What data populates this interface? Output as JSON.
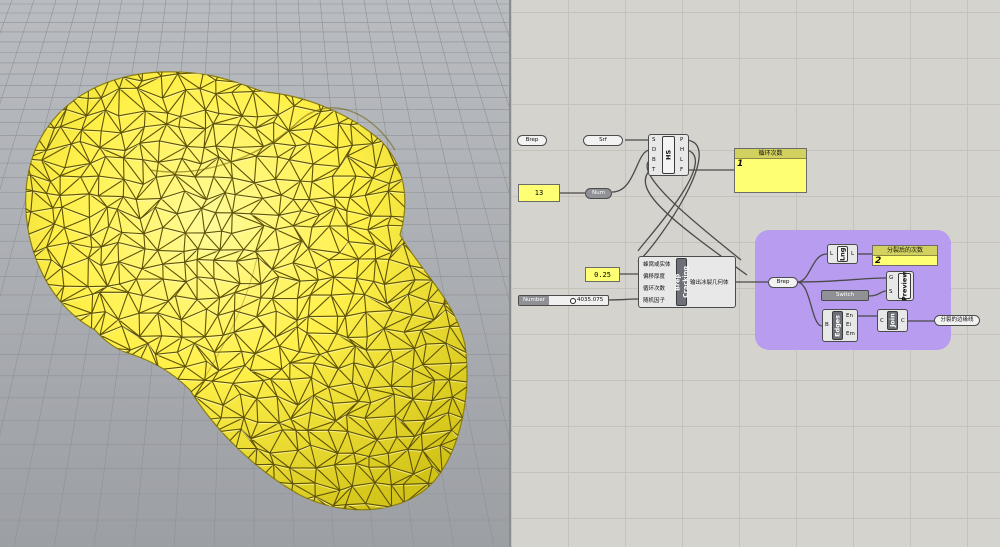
{
  "viewport": {
    "object_color": "#fff15a",
    "background_color": "#a7acb2"
  },
  "canvas": {
    "background_color": "#d5d3cd",
    "cluster_color": "#b79cef",
    "params": {
      "brep": "Brep",
      "srf": "Srf",
      "num": "Num",
      "number": "Number",
      "brep2": "Brep",
      "switch": "Switch"
    },
    "slider": {
      "value": "4035.075"
    },
    "hs": {
      "title": "HS",
      "inputs": [
        "S",
        "D",
        "B",
        "T"
      ],
      "outputs": [
        "P",
        "H",
        "L",
        "F"
      ]
    },
    "num_panel": {
      "value": "13"
    },
    "loop_panel": {
      "header": "循环次数",
      "value": "1"
    },
    "factor_panel": {
      "value": "0.25"
    },
    "cracking": {
      "title": "Brep Cracking",
      "inputs": [
        "蜂窝或实体",
        "偏移厚度",
        "循环次数",
        "随机因子"
      ],
      "output": "输出冰裂几何体"
    },
    "lng": {
      "title": "Lng",
      "input": "L",
      "output": "L"
    },
    "split_panel": {
      "header": "分裂后的次数",
      "value": "2"
    },
    "preview": {
      "title": "Preview",
      "inputs": [
        "G",
        "S"
      ]
    },
    "edges": {
      "title": "Edges",
      "input": "B",
      "outputs": [
        "En",
        "Ei",
        "Em"
      ]
    },
    "join": {
      "title": "Join",
      "input": "C",
      "output": "C"
    },
    "split_edges": {
      "label": "分裂的边缘线"
    }
  }
}
